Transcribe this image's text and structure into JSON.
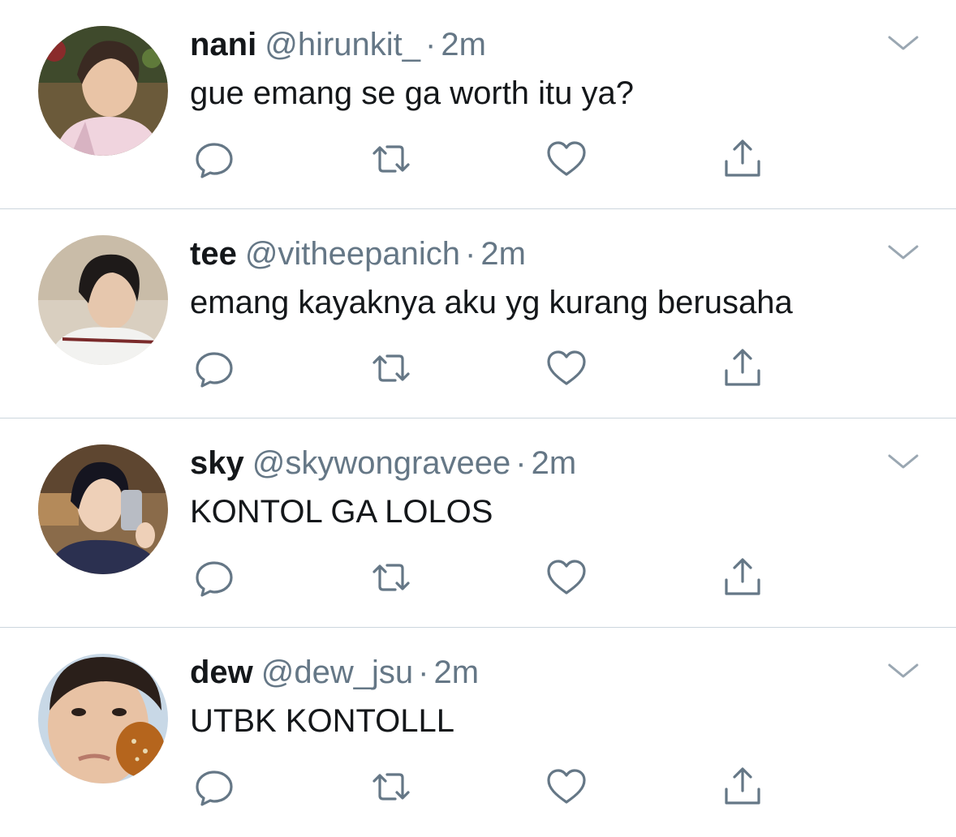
{
  "colors": {
    "text": "#14171a",
    "secondary": "#657786",
    "divider": "#ccd6dd",
    "icon": "#657786"
  },
  "tweets": [
    {
      "name": "nani",
      "handle": "@hirunkit_",
      "separator": "·",
      "time": "2m",
      "text": "gue emang se ga worth itu ya?",
      "avatar_icon": "avatar-photo"
    },
    {
      "name": "tee",
      "handle": "@vitheepanich",
      "separator": "·",
      "time": "2m",
      "text": "emang kayaknya aku yg kurang berusaha",
      "avatar_icon": "avatar-photo"
    },
    {
      "name": "sky",
      "handle": "@skywongraveee",
      "separator": "·",
      "time": "2m",
      "text": "KONTOL GA LOLOS",
      "avatar_icon": "avatar-photo"
    },
    {
      "name": "dew",
      "handle": "@dew_jsu",
      "separator": "·",
      "time": "2m",
      "text": "UTBK KONTOLLL",
      "avatar_icon": "avatar-photo"
    }
  ],
  "action_icons": [
    "reply-icon",
    "retweet-icon",
    "like-icon",
    "share-icon"
  ]
}
